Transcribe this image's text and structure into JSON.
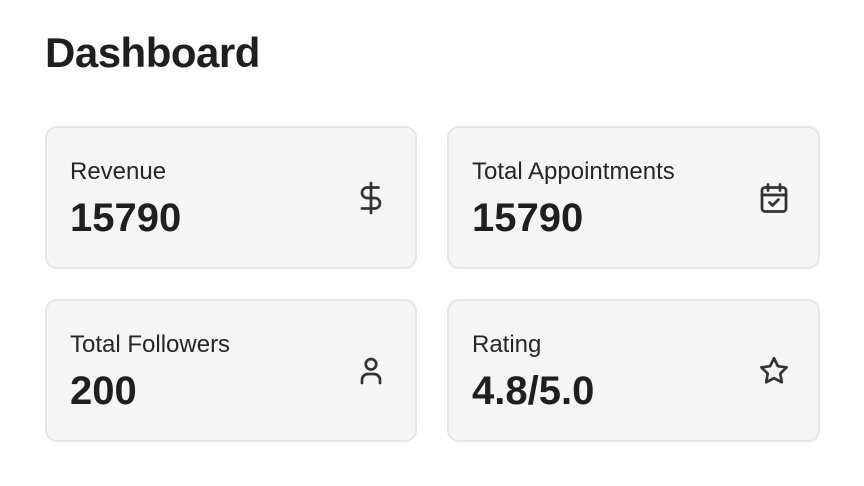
{
  "page": {
    "title": "Dashboard"
  },
  "cards": [
    {
      "label": "Revenue",
      "value": "15790",
      "icon": "dollar-icon"
    },
    {
      "label": "Total Appointments",
      "value": "15790",
      "icon": "calendar-check-icon"
    },
    {
      "label": "Total Followers",
      "value": "200",
      "icon": "user-icon"
    },
    {
      "label": "Rating",
      "value": "4.8/5.0",
      "icon": "star-icon"
    }
  ],
  "colors": {
    "card_background": "#f5f5f5",
    "card_border": "#e6e6e6",
    "text": "#1f1f1f"
  }
}
